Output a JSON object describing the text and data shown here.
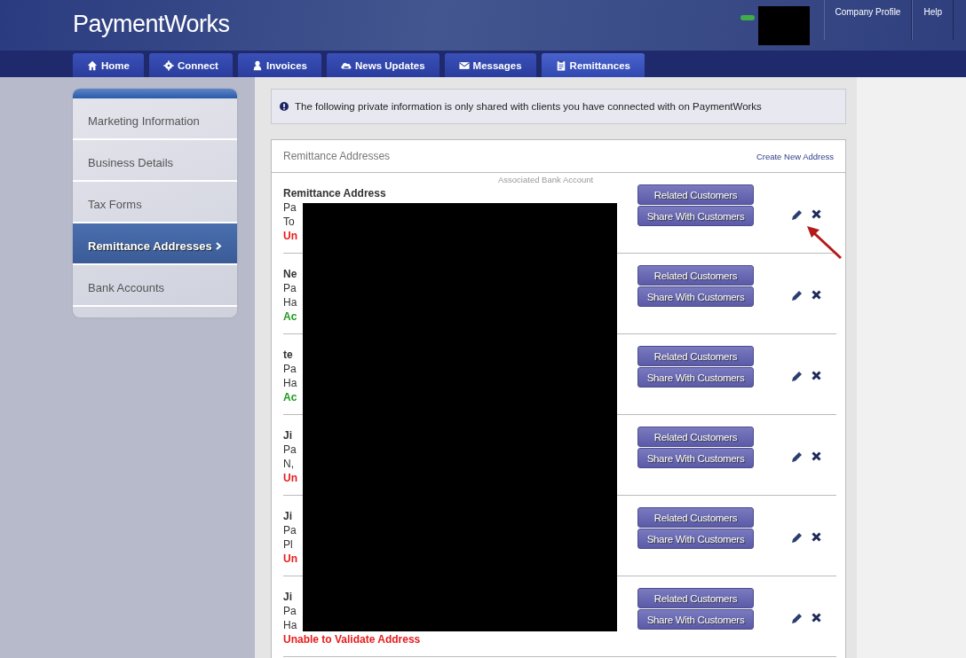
{
  "header": {
    "logo": "PaymentWorks",
    "links": [
      "Company Profile",
      "Help"
    ]
  },
  "nav_tabs": [
    {
      "label": "Home",
      "selected": false
    },
    {
      "label": "Connect",
      "selected": false
    },
    {
      "label": "Invoices",
      "selected": false
    },
    {
      "label": "News Updates",
      "selected": false
    },
    {
      "label": "Messages",
      "selected": false
    },
    {
      "label": "Remittances",
      "selected": true
    }
  ],
  "sidebar": {
    "items": [
      {
        "label": "Marketing Information",
        "selected": false
      },
      {
        "label": "Business Details",
        "selected": false
      },
      {
        "label": "Tax Forms",
        "selected": false
      },
      {
        "label": "Remittance Addresses",
        "selected": true
      },
      {
        "label": "Bank Accounts",
        "selected": false
      }
    ]
  },
  "notice": "The following private information is only shared with clients you have connected with on PaymentWorks",
  "card": {
    "title": "Remittance Addresses",
    "create_link": "Create New Address",
    "rows": [
      {
        "title": "Remittance Address",
        "line_2": "Pa",
        "line_3": "To",
        "bank_label": "Associated Bank Account",
        "status": {
          "text": "Un",
          "kind": "unable"
        },
        "buttons": [
          "Related Customers",
          "Share With Customers"
        ]
      },
      {
        "title": "Ne",
        "line_2": "Pa",
        "line_3": "Ha",
        "status": {
          "text": "Ac",
          "kind": "accepted"
        },
        "buttons": [
          "Related Customers",
          "Share With Customers"
        ]
      },
      {
        "title": "te",
        "line_2": "Pa",
        "line_3": "Ha",
        "status": {
          "text": "Ac",
          "kind": "accepted"
        },
        "buttons": [
          "Related Customers",
          "Share With Customers"
        ]
      },
      {
        "title": "Ji",
        "line_2": "Pa",
        "line_3": "N,",
        "status": {
          "text": "Un",
          "kind": "unable"
        },
        "buttons": [
          "Related Customers",
          "Share With Customers"
        ]
      },
      {
        "title": "Ji",
        "line_2": "Pa",
        "line_3": "Pl",
        "status": {
          "text": "Un",
          "kind": "unable"
        },
        "buttons": [
          "Related Customers",
          "Share With Customers"
        ]
      },
      {
        "title": "Ji",
        "line_2": "Pa",
        "line_3": "Ha",
        "status": {
          "text": "Unable to Validate Address",
          "kind": "unable"
        },
        "buttons": [
          "Related Customers",
          "Share With Customers"
        ]
      }
    ]
  }
}
